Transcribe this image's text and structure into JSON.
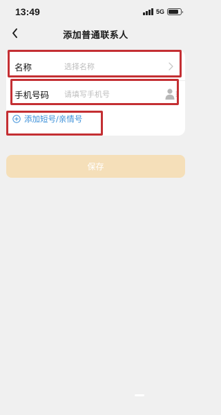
{
  "status_bar": {
    "time": "13:49",
    "network": "5G",
    "battery_level": 0.85
  },
  "nav": {
    "title": "添加普通联系人",
    "back_icon": "chevron-left-icon"
  },
  "form": {
    "name_label": "名称",
    "name_placeholder": "选择名称",
    "phone_label": "手机号码",
    "phone_placeholder": "请填写手机号",
    "add_link_label": "添加短号/亲情号"
  },
  "actions": {
    "save_label": "保存"
  },
  "colors": {
    "accent_link": "#3a8fd9",
    "save_button_disabled": "#f5dfb9",
    "highlight_box": "#c42f33",
    "background": "#f0f0f0"
  }
}
